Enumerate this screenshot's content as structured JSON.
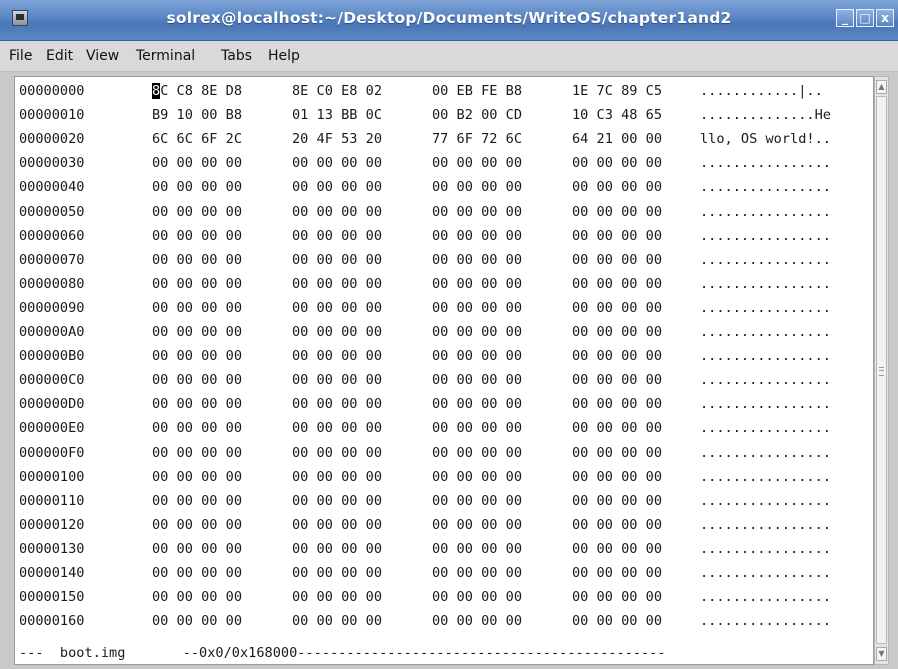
{
  "window": {
    "title": "solrex@localhost:~/Desktop/Documents/WriteOS/chapter1and2",
    "minimize_glyph": "_",
    "maximize_glyph": "□",
    "close_glyph": "x"
  },
  "menu": [
    "File",
    "Edit",
    "View",
    "Terminal",
    "Tabs",
    "Help"
  ],
  "hexdump": {
    "rows": [
      {
        "offset": "00000000",
        "groups": [
          "8C C8 8E D8",
          "8E C0 E8 02",
          "00 EB FE B8",
          "1E 7C 89 C5"
        ],
        "ascii": "............|.."
      },
      {
        "offset": "00000010",
        "groups": [
          "B9 10 00 B8",
          "01 13 BB 0C",
          "00 B2 00 CD",
          "10 C3 48 65"
        ],
        "ascii": "..............He"
      },
      {
        "offset": "00000020",
        "groups": [
          "6C 6C 6F 2C",
          "20 4F 53 20",
          "77 6F 72 6C",
          "64 21 00 00"
        ],
        "ascii": "llo, OS world!.."
      },
      {
        "offset": "00000030",
        "groups": [
          "00 00 00 00",
          "00 00 00 00",
          "00 00 00 00",
          "00 00 00 00"
        ],
        "ascii": "................"
      },
      {
        "offset": "00000040",
        "groups": [
          "00 00 00 00",
          "00 00 00 00",
          "00 00 00 00",
          "00 00 00 00"
        ],
        "ascii": "................"
      },
      {
        "offset": "00000050",
        "groups": [
          "00 00 00 00",
          "00 00 00 00",
          "00 00 00 00",
          "00 00 00 00"
        ],
        "ascii": "................"
      },
      {
        "offset": "00000060",
        "groups": [
          "00 00 00 00",
          "00 00 00 00",
          "00 00 00 00",
          "00 00 00 00"
        ],
        "ascii": "................"
      },
      {
        "offset": "00000070",
        "groups": [
          "00 00 00 00",
          "00 00 00 00",
          "00 00 00 00",
          "00 00 00 00"
        ],
        "ascii": "................"
      },
      {
        "offset": "00000080",
        "groups": [
          "00 00 00 00",
          "00 00 00 00",
          "00 00 00 00",
          "00 00 00 00"
        ],
        "ascii": "................"
      },
      {
        "offset": "00000090",
        "groups": [
          "00 00 00 00",
          "00 00 00 00",
          "00 00 00 00",
          "00 00 00 00"
        ],
        "ascii": "................"
      },
      {
        "offset": "000000A0",
        "groups": [
          "00 00 00 00",
          "00 00 00 00",
          "00 00 00 00",
          "00 00 00 00"
        ],
        "ascii": "................"
      },
      {
        "offset": "000000B0",
        "groups": [
          "00 00 00 00",
          "00 00 00 00",
          "00 00 00 00",
          "00 00 00 00"
        ],
        "ascii": "................"
      },
      {
        "offset": "000000C0",
        "groups": [
          "00 00 00 00",
          "00 00 00 00",
          "00 00 00 00",
          "00 00 00 00"
        ],
        "ascii": "................"
      },
      {
        "offset": "000000D0",
        "groups": [
          "00 00 00 00",
          "00 00 00 00",
          "00 00 00 00",
          "00 00 00 00"
        ],
        "ascii": "................"
      },
      {
        "offset": "000000E0",
        "groups": [
          "00 00 00 00",
          "00 00 00 00",
          "00 00 00 00",
          "00 00 00 00"
        ],
        "ascii": "................"
      },
      {
        "offset": "000000F0",
        "groups": [
          "00 00 00 00",
          "00 00 00 00",
          "00 00 00 00",
          "00 00 00 00"
        ],
        "ascii": "................"
      },
      {
        "offset": "00000100",
        "groups": [
          "00 00 00 00",
          "00 00 00 00",
          "00 00 00 00",
          "00 00 00 00"
        ],
        "ascii": "................"
      },
      {
        "offset": "00000110",
        "groups": [
          "00 00 00 00",
          "00 00 00 00",
          "00 00 00 00",
          "00 00 00 00"
        ],
        "ascii": "................"
      },
      {
        "offset": "00000120",
        "groups": [
          "00 00 00 00",
          "00 00 00 00",
          "00 00 00 00",
          "00 00 00 00"
        ],
        "ascii": "................"
      },
      {
        "offset": "00000130",
        "groups": [
          "00 00 00 00",
          "00 00 00 00",
          "00 00 00 00",
          "00 00 00 00"
        ],
        "ascii": "................"
      },
      {
        "offset": "00000140",
        "groups": [
          "00 00 00 00",
          "00 00 00 00",
          "00 00 00 00",
          "00 00 00 00"
        ],
        "ascii": "................"
      },
      {
        "offset": "00000150",
        "groups": [
          "00 00 00 00",
          "00 00 00 00",
          "00 00 00 00",
          "00 00 00 00"
        ],
        "ascii": "................"
      },
      {
        "offset": "00000160",
        "groups": [
          "00 00 00 00",
          "00 00 00 00",
          "00 00 00 00",
          "00 00 00 00"
        ],
        "ascii": "................"
      }
    ]
  },
  "status_line": "---  boot.img       --0x0/0x168000---------------------------------------------"
}
